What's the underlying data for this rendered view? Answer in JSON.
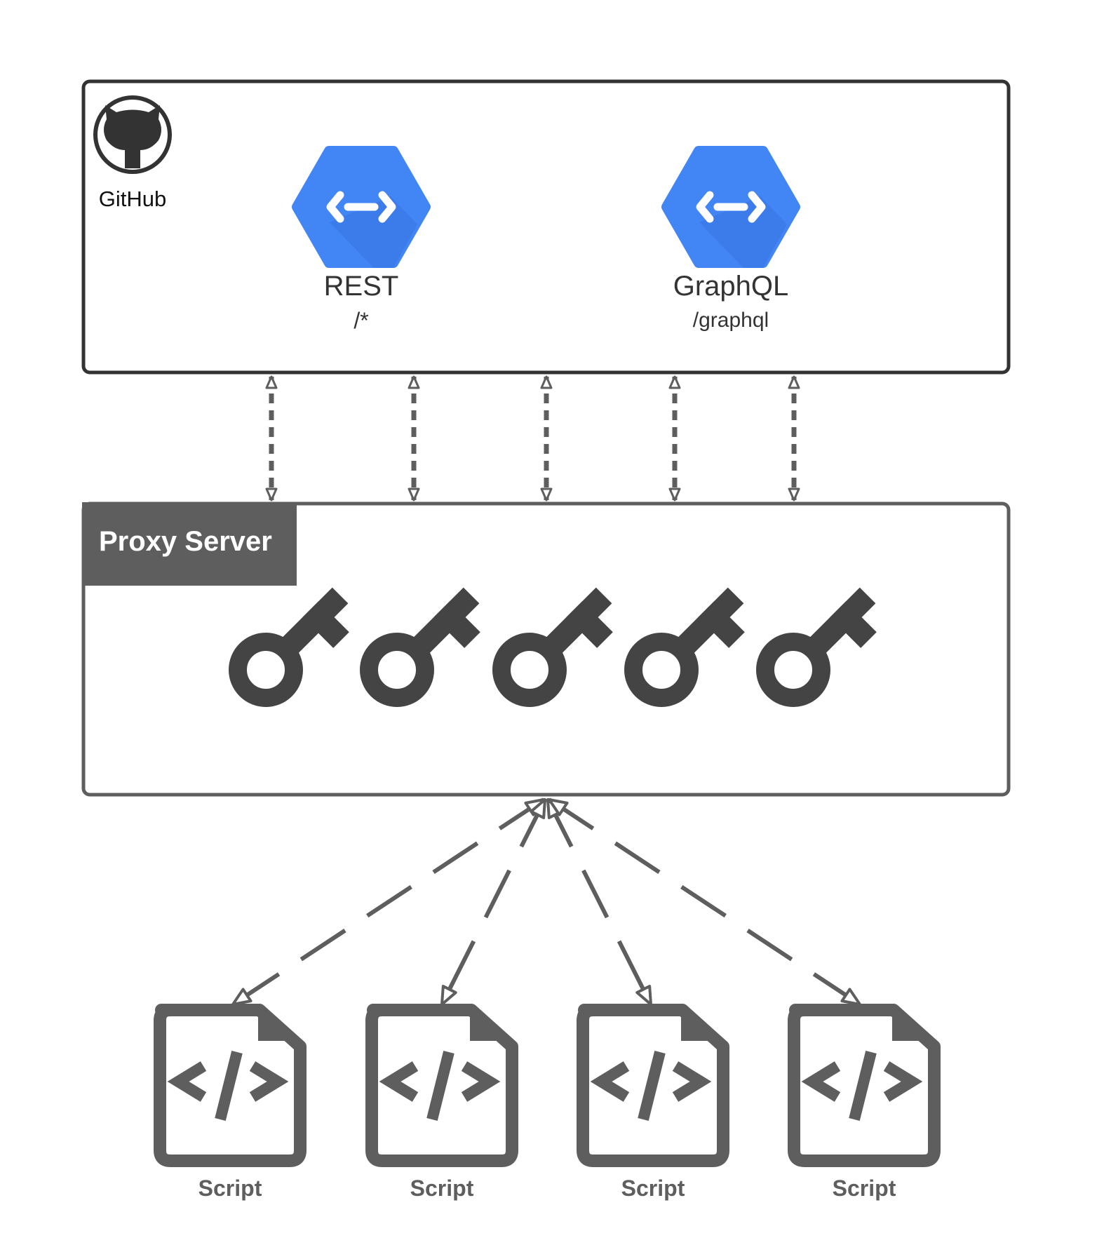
{
  "github": {
    "label": "GitHub",
    "icon": "github-octocat-icon"
  },
  "apis": [
    {
      "name": "REST",
      "path": "/*",
      "icon": "api-endpoint-icon"
    },
    {
      "name": "GraphQL",
      "path": "/graphql",
      "icon": "api-endpoint-icon"
    }
  ],
  "proxy": {
    "title": "Proxy Server",
    "key_icon": "key-icon",
    "key_count": 5
  },
  "scripts": [
    {
      "label": "Script",
      "icon": "code-file-icon"
    },
    {
      "label": "Script",
      "icon": "code-file-icon"
    },
    {
      "label": "Script",
      "icon": "code-file-icon"
    },
    {
      "label": "Script",
      "icon": "code-file-icon"
    }
  ],
  "colors": {
    "api_blue": "#4285f4",
    "api_shadow": "#3b78e7",
    "dark": "#333333",
    "gray": "#5e5e5e"
  }
}
